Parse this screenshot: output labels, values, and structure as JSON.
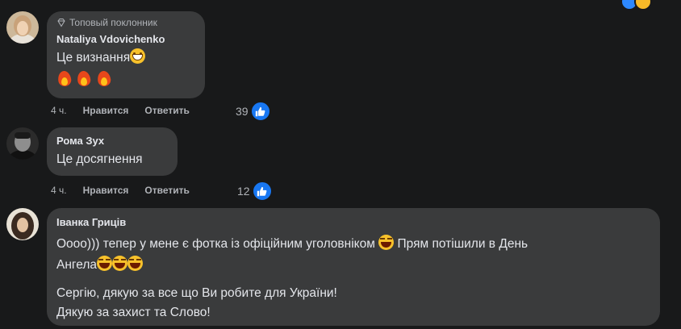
{
  "colors": {
    "background": "#18191a",
    "bubble": "#3a3b3c",
    "text": "#e4e6eb",
    "secondary": "#b0b3b8",
    "like_blue": "#1877f2"
  },
  "comments": [
    {
      "badge": "Топовый поклонник",
      "author": "Nataliya Vdovichenko",
      "text": "Це визнання",
      "emoji_line": [
        "fire-emoji",
        "fire-emoji",
        "fire-emoji"
      ],
      "time": "4 ч.",
      "like": "Нравится",
      "reply": "Ответить",
      "reactions": "39"
    },
    {
      "author": "Рома Зух",
      "text": "Це досягнення",
      "time": "4 ч.",
      "like": "Нравится",
      "reply": "Ответить",
      "reactions": "12"
    },
    {
      "author": "Іванка Гриців",
      "line1a": "Оооо))) тепер у мене є фотка із офіційним уголовніком",
      "line1b": "Прям потішили в День",
      "line2": "Ангела",
      "line3": "Сергію, дякую за все що Ви робите для України!",
      "line4": "Дякую за захист та Слово!"
    }
  ]
}
